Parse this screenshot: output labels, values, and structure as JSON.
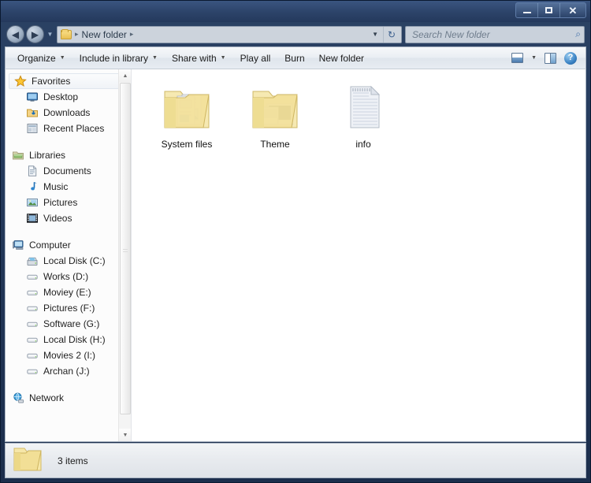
{
  "window": {
    "controls": [
      {
        "name": "minimize-button",
        "label": "—"
      },
      {
        "name": "maximize-button",
        "label": "□"
      },
      {
        "name": "close-button",
        "label": "✕"
      }
    ]
  },
  "address": {
    "back_icon": "◀",
    "forward_icon": "▶",
    "history_caret": "▼",
    "folder_icon": "folder-icon",
    "separator": "▸",
    "crumb": "New folder",
    "dropdown_caret": "▼",
    "refresh_icon": "↻"
  },
  "search": {
    "placeholder": "Search New folder",
    "icon": "⌕"
  },
  "toolbar": {
    "items": [
      {
        "label": "Organize",
        "caret": "▼"
      },
      {
        "label": "Include in library",
        "caret": "▼"
      },
      {
        "label": "Share with",
        "caret": "▼"
      },
      {
        "label": "Play all",
        "caret": ""
      },
      {
        "label": "Burn",
        "caret": ""
      },
      {
        "label": "New folder",
        "caret": ""
      }
    ],
    "view_caret": "▼",
    "help_label": "?"
  },
  "sidebar": {
    "groups": [
      {
        "header": {
          "label": "Favorites",
          "icon": "star-icon",
          "selected": true
        },
        "items": [
          {
            "label": "Desktop",
            "icon": "desktop-icon"
          },
          {
            "label": "Downloads",
            "icon": "downloads-icon"
          },
          {
            "label": "Recent Places",
            "icon": "recent-places-icon"
          }
        ]
      },
      {
        "header": {
          "label": "Libraries",
          "icon": "libraries-icon",
          "selected": false
        },
        "items": [
          {
            "label": "Documents",
            "icon": "documents-icon"
          },
          {
            "label": "Music",
            "icon": "music-icon"
          },
          {
            "label": "Pictures",
            "icon": "pictures-icon"
          },
          {
            "label": "Videos",
            "icon": "videos-icon"
          }
        ]
      },
      {
        "header": {
          "label": "Computer",
          "icon": "computer-icon",
          "selected": false
        },
        "items": [
          {
            "label": "Local Disk (C:)",
            "icon": "system-drive-icon"
          },
          {
            "label": "Works (D:)",
            "icon": "drive-icon"
          },
          {
            "label": "Moviey (E:)",
            "icon": "drive-icon"
          },
          {
            "label": "Pictures (F:)",
            "icon": "drive-icon"
          },
          {
            "label": "Software (G:)",
            "icon": "drive-icon"
          },
          {
            "label": "Local Disk (H:)",
            "icon": "drive-icon"
          },
          {
            "label": "Movies  2 (I:)",
            "icon": "drive-icon"
          },
          {
            "label": "Archan (J:)",
            "icon": "drive-icon"
          }
        ]
      },
      {
        "header": {
          "label": "Network",
          "icon": "network-icon",
          "selected": false
        },
        "items": []
      }
    ],
    "scroll": {
      "up_arrow": "▲",
      "down_arrow": "▼"
    }
  },
  "content": {
    "items": [
      {
        "label": "System files",
        "icon": "folder-with-documents-icon",
        "type": "folder"
      },
      {
        "label": "Theme",
        "icon": "folder-with-photos-icon",
        "type": "folder"
      },
      {
        "label": "info",
        "icon": "text-document-icon",
        "type": "file"
      }
    ]
  },
  "status": {
    "icon": "folder-icon",
    "text": "3 items"
  },
  "colors": {
    "frame": "#24395c",
    "folder_yellow": "#f2dc9a",
    "toolbar_bg": "#eaeef3",
    "content_bg": "#ffffff"
  }
}
